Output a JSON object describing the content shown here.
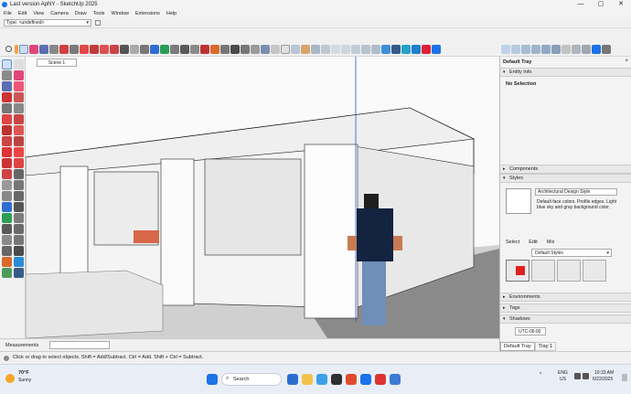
{
  "window": {
    "title": "Last version ApNY - SketchUp 2025",
    "controls": [
      "—",
      "▢",
      "✕"
    ]
  },
  "menu": [
    "File",
    "Edit",
    "View",
    "Camera",
    "Draw",
    "Tools",
    "Window",
    "Extensions",
    "Help"
  ],
  "tag_selector": {
    "value": "Type: <undefined>"
  },
  "scene_tab": "Scene 1",
  "tray": {
    "title": "Default Tray",
    "entity_info": {
      "header": "Entity Info",
      "value": "No Selection"
    },
    "components_header": "Components",
    "styles": {
      "header": "Styles",
      "style_name": "Architectural Design Style",
      "description": "Default face colors. Profile edges. Light blue sky and gray background color.",
      "tabs": [
        "Select",
        "Edit",
        "Mix"
      ],
      "library": "Default Styles"
    },
    "environments_header": "Environments",
    "tags_header": "Tags",
    "shadows_header": "Shadows",
    "timezone": "UTC-06:00",
    "bottom_tabs": [
      "Default Tray",
      "Tray 1"
    ]
  },
  "measurements_label": "Measurements",
  "status_hint": "Click or drag to select objects. Shift = Add/Subtract. Ctrl = Add. Shift + Ctrl = Subtract.",
  "taskbar": {
    "weather_temp": "70°F",
    "weather_desc": "Sunny",
    "search_placeholder": "Search",
    "lang": "ENG",
    "region": "US",
    "time": "10:33 AM",
    "date": "6/22/2025"
  },
  "colors": {
    "accent": "#1a73e8",
    "panel": "#f3f3f3",
    "ground": "#bdbdbd",
    "sky": "#ffffff"
  }
}
